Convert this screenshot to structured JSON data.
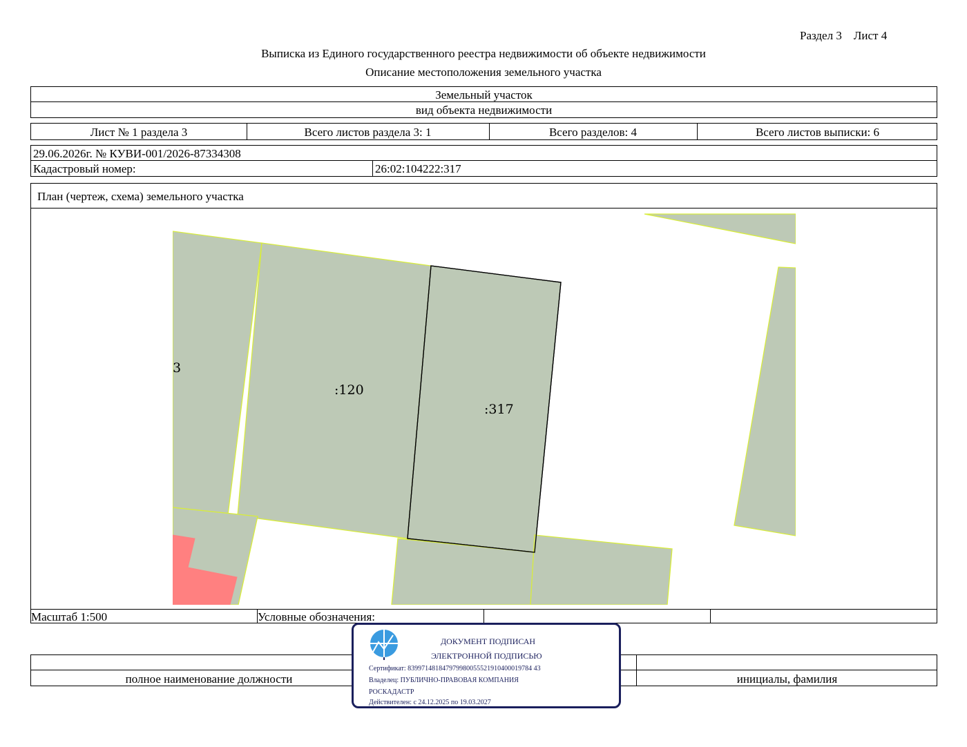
{
  "header": {
    "section_ref": "Раздел 3",
    "sheet_ref": "Лист 4",
    "title": "Выписка из Единого государственного реестра недвижимости об объекте недвижимости",
    "subtitle": "Описание местоположения земельного участка"
  },
  "object": {
    "type_value": "Земельный участок",
    "type_caption": "вид объекта недвижимости"
  },
  "sheet_info": {
    "sheet_no": "Лист № 1 раздела 3",
    "total_sheets_section": "Всего листов раздела 3: 1",
    "total_sections": "Всего разделов: 4",
    "total_sheets_extract": "Всего листов выписки: 6"
  },
  "record": {
    "date_number": "29.06.2026г. № КУВИ-001/2026-87334308",
    "cadastral_label": "Кадастровый номер:",
    "cadastral_value": "26:02:104222:317"
  },
  "plan": {
    "caption": "План (чертеж, схема) земельного участка",
    "parcel_labels": [
      ":120",
      ":317",
      "3"
    ],
    "colors": {
      "parcel_fill": "#bdc9b6",
      "parcel_border": "#d8ec3c",
      "target_border": "#000000",
      "highlight_fill": "#ff8080"
    }
  },
  "footer": {
    "scale": "Масштаб 1:500",
    "legend_label": "Условные обозначения:",
    "position_caption": "полное наименование должности",
    "name_caption": "инициалы, фамилия"
  },
  "stamp": {
    "icon": "roskadastr-logo-icon",
    "line1": "ДОКУМЕНТ ПОДПИСАН",
    "line2": "ЭЛЕКТРОННОЙ ПОДПИСЬЮ",
    "certificate": "Сертификат: 839971481847979980055521910400019784 43",
    "owner_line1": "Владелец: ПУБЛИЧНО-ПРАВОВАЯ КОМПАНИЯ",
    "owner_line2": "РОСКАДАСТР",
    "validity": "Действителен: с 24.12.2025 по 19.03.2027",
    "border_color": "#1a1f5c"
  }
}
